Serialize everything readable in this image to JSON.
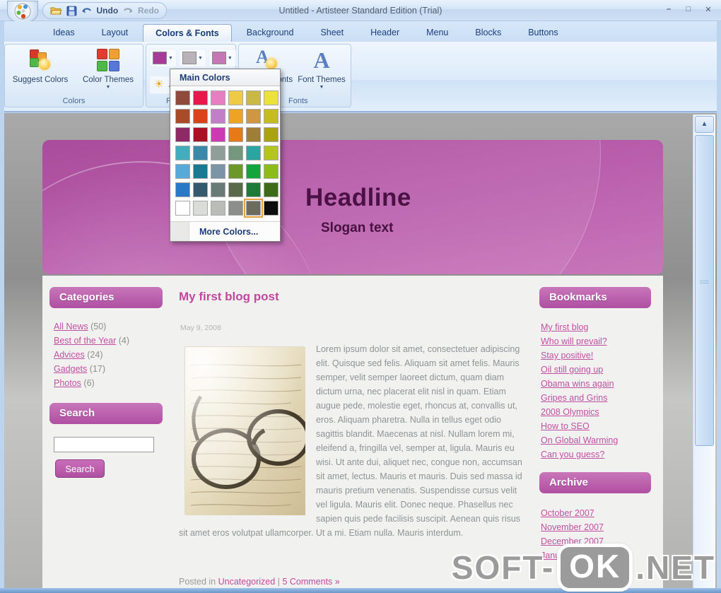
{
  "window": {
    "title": "Untitled - Artisteer Standard Edition (Trial)",
    "quick_access": {
      "undo": "Undo",
      "redo": "Redo"
    }
  },
  "ribbon": {
    "tabs": [
      {
        "label": "Ideas"
      },
      {
        "label": "Layout"
      },
      {
        "label": "Colors & Fonts",
        "active": true
      },
      {
        "label": "Background"
      },
      {
        "label": "Sheet"
      },
      {
        "label": "Header"
      },
      {
        "label": "Menu"
      },
      {
        "label": "Blocks"
      },
      {
        "label": "Buttons"
      }
    ],
    "groups": {
      "colors": {
        "label": "Colors",
        "suggest_colors": "Suggest Colors",
        "color_themes": "Color Themes"
      },
      "palette": {
        "label": "Palette",
        "adjust_label": "Adjust"
      },
      "fonts": {
        "label": "Fonts",
        "suggest_fonts": "Suggest Fonts",
        "font_themes": "Font Themes"
      }
    },
    "palette_chips": [
      {
        "c": "#a53c98"
      },
      {
        "c": "#b9b2b9",
        "sel": true
      },
      {
        "c": "#c577b5"
      }
    ]
  },
  "color_dropdown": {
    "title": "Main Colors",
    "more_colors": "More Colors...",
    "swatches": [
      {
        "c": "#8f4a3c"
      },
      {
        "c": "#e6194a"
      },
      {
        "c": "#e57fc1"
      },
      {
        "c": "#efca45"
      },
      {
        "c": "#c9b944"
      },
      {
        "c": "#ece23c"
      },
      {
        "c": "#a94b28"
      },
      {
        "c": "#d84417"
      },
      {
        "c": "#c27fc7"
      },
      {
        "c": "#efa325"
      },
      {
        "c": "#cf9742"
      },
      {
        "c": "#c4bc20"
      },
      {
        "c": "#8e2a66"
      },
      {
        "c": "#ab1123"
      },
      {
        "c": "#cb3ab3"
      },
      {
        "c": "#e87917"
      },
      {
        "c": "#9f7e37"
      },
      {
        "c": "#aaa211"
      },
      {
        "c": "#42adbc"
      },
      {
        "c": "#3a89ab"
      },
      {
        "c": "#909e9a"
      },
      {
        "c": "#73987b"
      },
      {
        "c": "#2aa6a2"
      },
      {
        "c": "#b6c51d"
      },
      {
        "c": "#57a9d9"
      },
      {
        "c": "#197b93"
      },
      {
        "c": "#7b94a6"
      },
      {
        "c": "#6c9729"
      },
      {
        "c": "#13a53d"
      },
      {
        "c": "#8dbb18"
      },
      {
        "c": "#2a79c9"
      },
      {
        "c": "#33596f"
      },
      {
        "c": "#6a7b77"
      },
      {
        "c": "#5b694b"
      },
      {
        "c": "#1d7b39"
      },
      {
        "c": "#3e6b17"
      },
      {
        "c": "#ffffff"
      },
      {
        "c": "#dadcd7"
      },
      {
        "c": "#babcb7"
      },
      {
        "c": "#8c8e8a"
      },
      {
        "c": "#6c6c5e",
        "sel": true
      },
      {
        "c": "#0d0d0d"
      }
    ]
  },
  "preview": {
    "header": {
      "headline": "Headline",
      "slogan": "Slogan text"
    },
    "left_sidebar": {
      "categories": {
        "title": "Categories",
        "items": [
          {
            "label": "All News",
            "count": "(50)"
          },
          {
            "label": "Best of the Year",
            "count": "(4)"
          },
          {
            "label": "Advices",
            "count": "(24)"
          },
          {
            "label": "Gadgets",
            "count": "(17)"
          },
          {
            "label": "Photos",
            "count": "(6)"
          }
        ]
      },
      "search": {
        "title": "Search",
        "button": "Search"
      }
    },
    "post": {
      "title": "My first blog post",
      "date": "May 9, 2008",
      "body": "Lorem ipsum dolor sit amet, consectetuer adipiscing elit. Quisque sed felis. Aliquam sit amet felis. Mauris semper, velit semper laoreet dictum, quam diam dictum urna, nec placerat elit nisl in quam. Etiam augue pede, molestie eget, rhoncus at, convallis ut, eros. Aliquam pharetra. Nulla in tellus eget odio sagittis blandit. Maecenas at nisl. Nullam lorem mi, eleifend a, fringilla vel, semper at, ligula. Mauris eu wisi. Ut ante dui, aliquet nec, congue non, accumsan sit amet, lectus. Mauris et mauris. Duis sed massa id mauris pretium venenatis. Suspendisse cursus velit vel ligula. Mauris elit. Donec neque. Phasellus nec sapien quis pede facilisis suscipit. Aenean quis risus sit amet eros volutpat ullamcorper. Ut a mi. Etiam nulla. Mauris interdum.",
      "footer": {
        "posted_in": "Posted in",
        "category": "Uncategorized",
        "separator": "|",
        "comments": "5 Comments »"
      }
    },
    "right_sidebar": {
      "bookmarks": {
        "title": "Bookmarks",
        "items": [
          "My first blog",
          "Who will prevail?",
          "Stay positive!",
          "Oil still going up",
          "Obama wins again",
          "Gripes and Grins",
          "2008 Olympics",
          "How to SEO",
          "On Global Warming",
          "Can you guess?"
        ]
      },
      "archive": {
        "title": "Archive",
        "items": [
          "October 2007",
          "November 2007",
          "December 2007",
          "January 2008"
        ]
      }
    }
  },
  "watermark": {
    "part1": "SOFT-",
    "part2": "OK",
    "part3": ".NET"
  },
  "colors": {
    "accent_pink": "#b04fa2",
    "link_pink": "#c2479e",
    "header_purple": "#4a1144",
    "ribbon_blue": "#dcebfa"
  }
}
